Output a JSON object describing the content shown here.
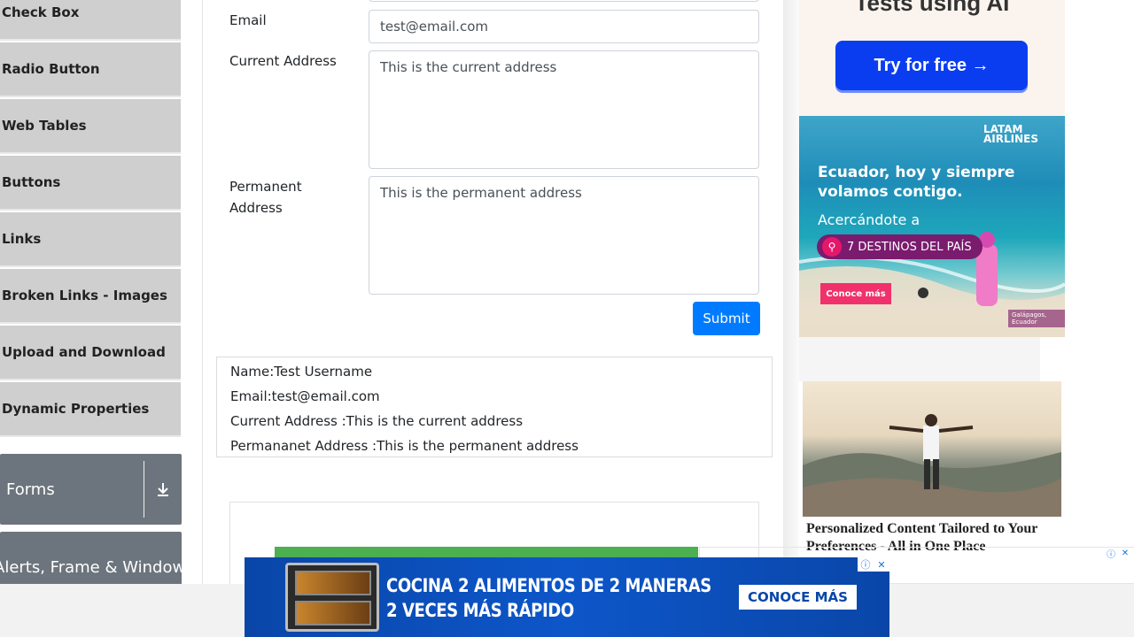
{
  "sidebar": {
    "items": [
      {
        "label": "Check Box"
      },
      {
        "label": "Radio Button"
      },
      {
        "label": "Web Tables"
      },
      {
        "label": "Buttons"
      },
      {
        "label": "Links"
      },
      {
        "label": "Broken Links - Images"
      },
      {
        "label": "Upload and Download"
      },
      {
        "label": "Dynamic Properties"
      }
    ],
    "groups": [
      {
        "label": "Forms"
      },
      {
        "label": "Alerts, Frame & Windows"
      }
    ]
  },
  "form": {
    "email_label": "Email",
    "email_value": "test@email.com",
    "current_label": "Current Address",
    "current_value": "This is the current address",
    "permanent_label": "Permanent Address",
    "permanent_value": "This is the permanent address",
    "submit_label": "Submit"
  },
  "output": {
    "name": "Name:Test Username",
    "email": "Email:test@email.com",
    "current": "Current Address :This is the current address",
    "permanent": "Permananet Address :This is the permanent address"
  },
  "ads": {
    "top_heading": "Tests using AI",
    "top_button": "Try for free →",
    "latam_logo": "LATAM AIRLINES",
    "latam_line1": "Ecuador, hoy y siempre",
    "latam_line2": "volamos contigo.",
    "latam_line3": "Acercándote a",
    "latam_pill": "7 DESTINOS DEL PAÍS",
    "latam_button": "Conoce más",
    "latam_location": "Galápagos, Ecuador",
    "side_caption": "Personalized Content Tailored to Your Preferences - All in One Place",
    "bottom_line1": "COCINA 2 ALIMENTOS DE 2 MANERAS",
    "bottom_line2": "2 VECES MÁS RÁPIDO",
    "bottom_cta": "CONOCE MÁS"
  },
  "colors": {
    "primary": "#007bff",
    "sidebar_item_bg": "#cfcfcf",
    "group_bg": "#6c757d"
  }
}
